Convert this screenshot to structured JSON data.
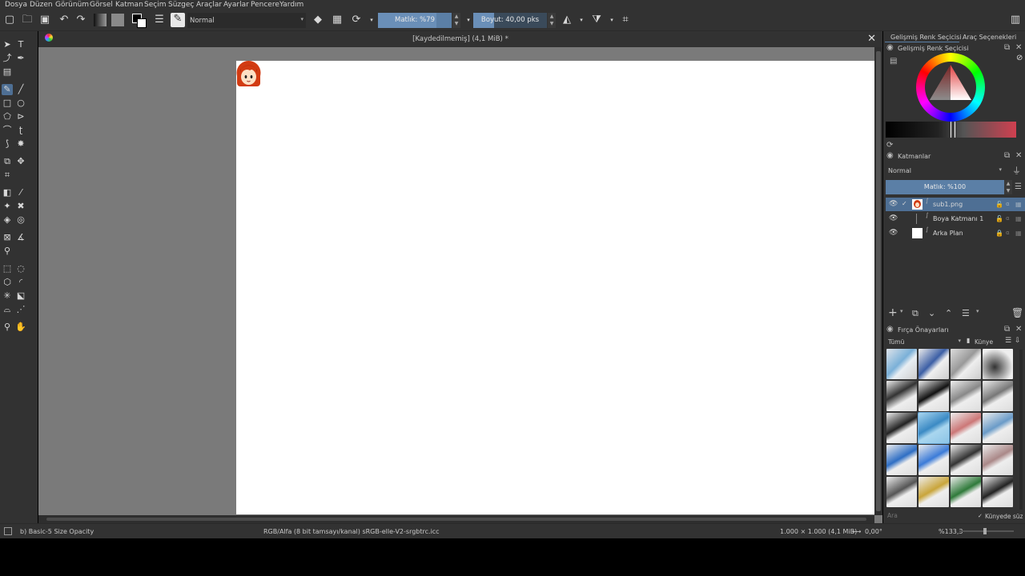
{
  "menubar": {
    "items": [
      "Dosya",
      "Düzen",
      "Görünüm",
      "Görsel",
      "Katman",
      "Seçim",
      "Süzgeç",
      "Araçlar",
      "Ayarlar",
      "Pencere",
      "Yardım"
    ]
  },
  "toolbar": {
    "blend_mode": "Normal",
    "opacity_label": "Matlık: %79",
    "opacity_value": 79,
    "size_label": "Boyut: 40,00 pks",
    "size_value": 40
  },
  "document": {
    "title": "[Kaydedilmemiş]  (4,1 MiB) *",
    "close_icon": "✕"
  },
  "dock": {
    "tab_color": "Gelişmiş Renk Seçicisi",
    "tab_tool": "Araç Seçenekleri",
    "color_panel_title": "Gelişmiş Renk Seçicisi",
    "layers_title": "Katmanlar",
    "layers_blend": "Normal",
    "layers_opacity": "Matlık: %100",
    "layers": [
      {
        "name": "sub1.png",
        "selected": true
      },
      {
        "name": "Boya Katmanı 1",
        "selected": false
      },
      {
        "name": "Arka Plan",
        "selected": false
      }
    ],
    "brushes_title": "Fırça Önayarları",
    "brushes_filter": "Tümü",
    "brushes_tag": "Künye",
    "search_placeholder": "Ara",
    "filter_in_tag": "Künyede süz"
  },
  "statusbar": {
    "brush_name": "b) Basic-5 Size Opacity",
    "color_profile": "RGB/Alfa (8 bit tamsayı/kanal)  sRGB-elle-V2-srgbtrc.icc",
    "image_size": "1.000 × 1.000 (4,1 MiB)",
    "rotation": "0,00°",
    "zoom": "%133,3"
  },
  "colors": {
    "accent": "#5b7fa6",
    "panel": "#323232",
    "canvas_bg": "#7a7a7a"
  }
}
